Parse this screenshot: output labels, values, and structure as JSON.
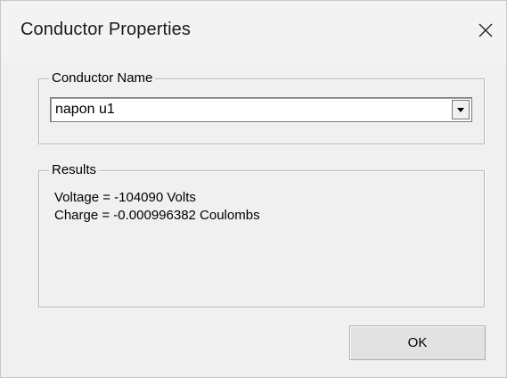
{
  "window": {
    "title": "Conductor Properties",
    "close_icon": "close-icon"
  },
  "conductor_name": {
    "legend": "Conductor Name",
    "selected_value": "napon u1",
    "dropdown_icon": "chevron-down-icon"
  },
  "results": {
    "legend": "Results",
    "voltage_line": "Voltage = -104090 Volts",
    "charge_line": "Charge = -0.000996382 Coulombs"
  },
  "buttons": {
    "ok_label": "OK"
  }
}
